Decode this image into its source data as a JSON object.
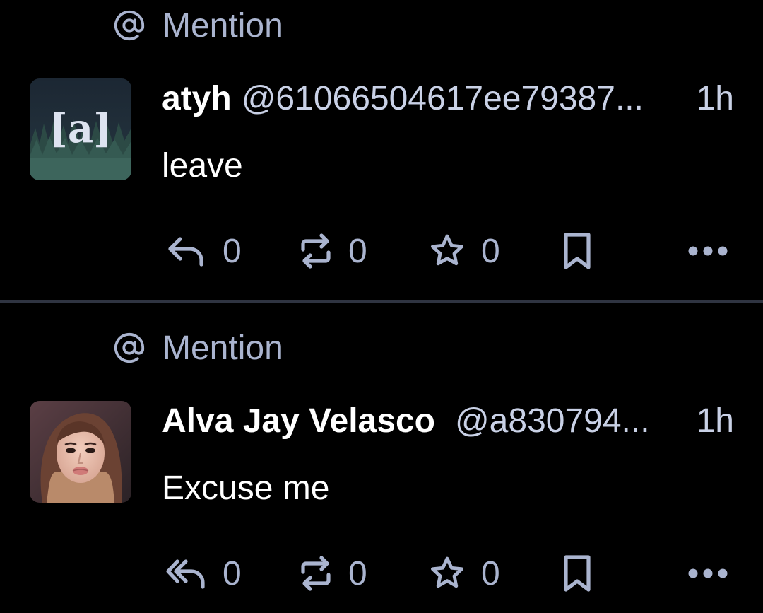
{
  "colors": {
    "background": "#000000",
    "muted": "#aab4cf",
    "divider": "#2f3441",
    "text": "#ffffff"
  },
  "notifications": [
    {
      "type_label": "Mention",
      "type_icon": "at-icon",
      "avatar_text": "[a]",
      "display_name": "atyh",
      "acct": "@61066504617ee79387...",
      "time": "1h",
      "content": "leave",
      "actions": {
        "reply_icon": "reply-icon",
        "reply_count": "0",
        "boost_icon": "boost-icon",
        "boost_count": "0",
        "favourite_icon": "star-icon",
        "favourite_count": "0",
        "bookmark_icon": "bookmark-icon",
        "more_icon": "more-icon"
      }
    },
    {
      "type_label": "Mention",
      "type_icon": "at-icon",
      "avatar_text": "",
      "display_name": "Alva Jay Velasco",
      "acct": "@a830794...",
      "time": "1h",
      "content": "Excuse me",
      "actions": {
        "reply_icon": "reply-all-icon",
        "reply_count": "0",
        "boost_icon": "boost-icon",
        "boost_count": "0",
        "favourite_icon": "star-icon",
        "favourite_count": "0",
        "bookmark_icon": "bookmark-icon",
        "more_icon": "more-icon"
      }
    }
  ]
}
